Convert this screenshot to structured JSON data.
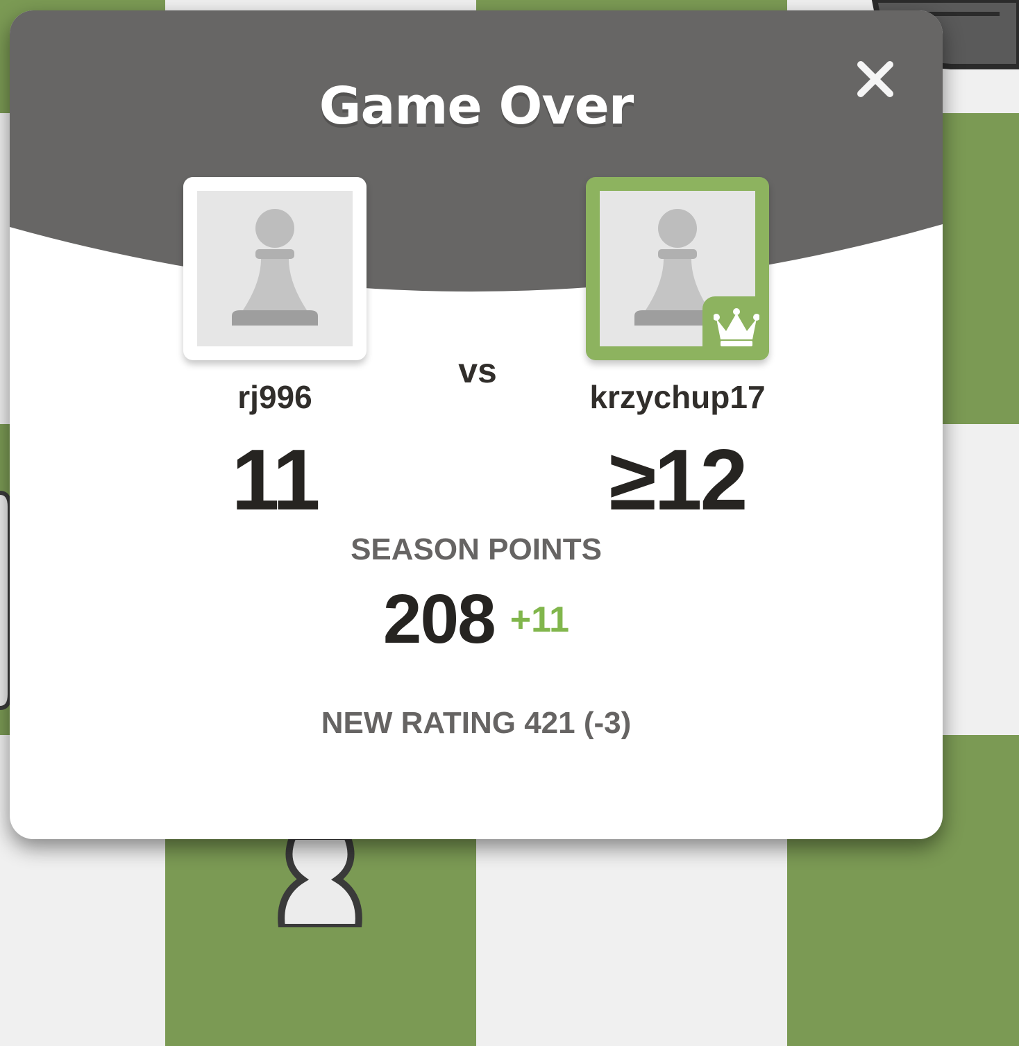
{
  "modal": {
    "title": "Game Over",
    "close_icon": "close-icon"
  },
  "players": [
    {
      "name": "rj996",
      "score": "11",
      "avatar_icon": "pawn-avatar-icon",
      "winner": false
    },
    {
      "name": "krzychup17",
      "score": "≥12",
      "avatar_icon": "pawn-avatar-icon",
      "winner": true,
      "badge_icon": "crown-icon"
    }
  ],
  "versus_label": "vs",
  "season": {
    "label": "SEASON POINTS",
    "points": "208",
    "delta": "+11"
  },
  "rating_text": "NEW RATING 421 (-3)",
  "colors": {
    "header": "#676665",
    "winner_accent": "#8db35f",
    "positive": "#81b64c",
    "board_dark": "#7b9a54",
    "board_light": "#f0f0f0"
  }
}
